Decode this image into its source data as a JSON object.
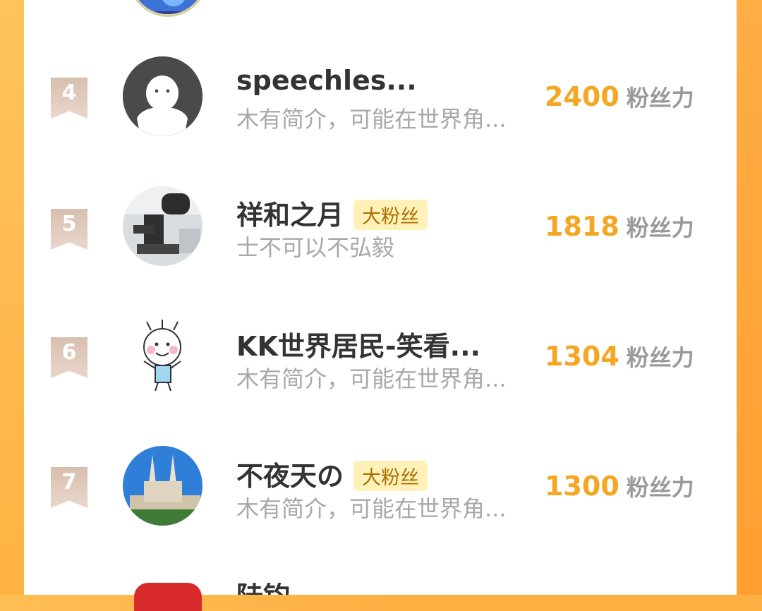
{
  "entries": [
    {
      "rank": "4",
      "name": "speechles...",
      "badge": "",
      "bio": "木有简介，可能在世界角...",
      "score": "2400",
      "unit": "粉丝力"
    },
    {
      "rank": "5",
      "name": "祥和之月",
      "badge": "大粉丝",
      "bio": "士不可以不弘毅",
      "score": "1818",
      "unit": "粉丝力"
    },
    {
      "rank": "6",
      "name": "KK世界居民-笑看...",
      "badge": "",
      "bio": "木有简介，可能在世界角...",
      "score": "1304",
      "unit": "粉丝力"
    },
    {
      "rank": "7",
      "name": "不夜天の",
      "badge": "大粉丝",
      "bio": "木有简介，可能在世界角...",
      "score": "1300",
      "unit": "粉丝力"
    }
  ],
  "partial_next": {
    "name": "陆钧"
  },
  "colors": {
    "accent": "#f5a623",
    "badge_bg": "#fff1b8",
    "badge_text": "#a96f00",
    "rank_bg": "#dcc3b2"
  }
}
